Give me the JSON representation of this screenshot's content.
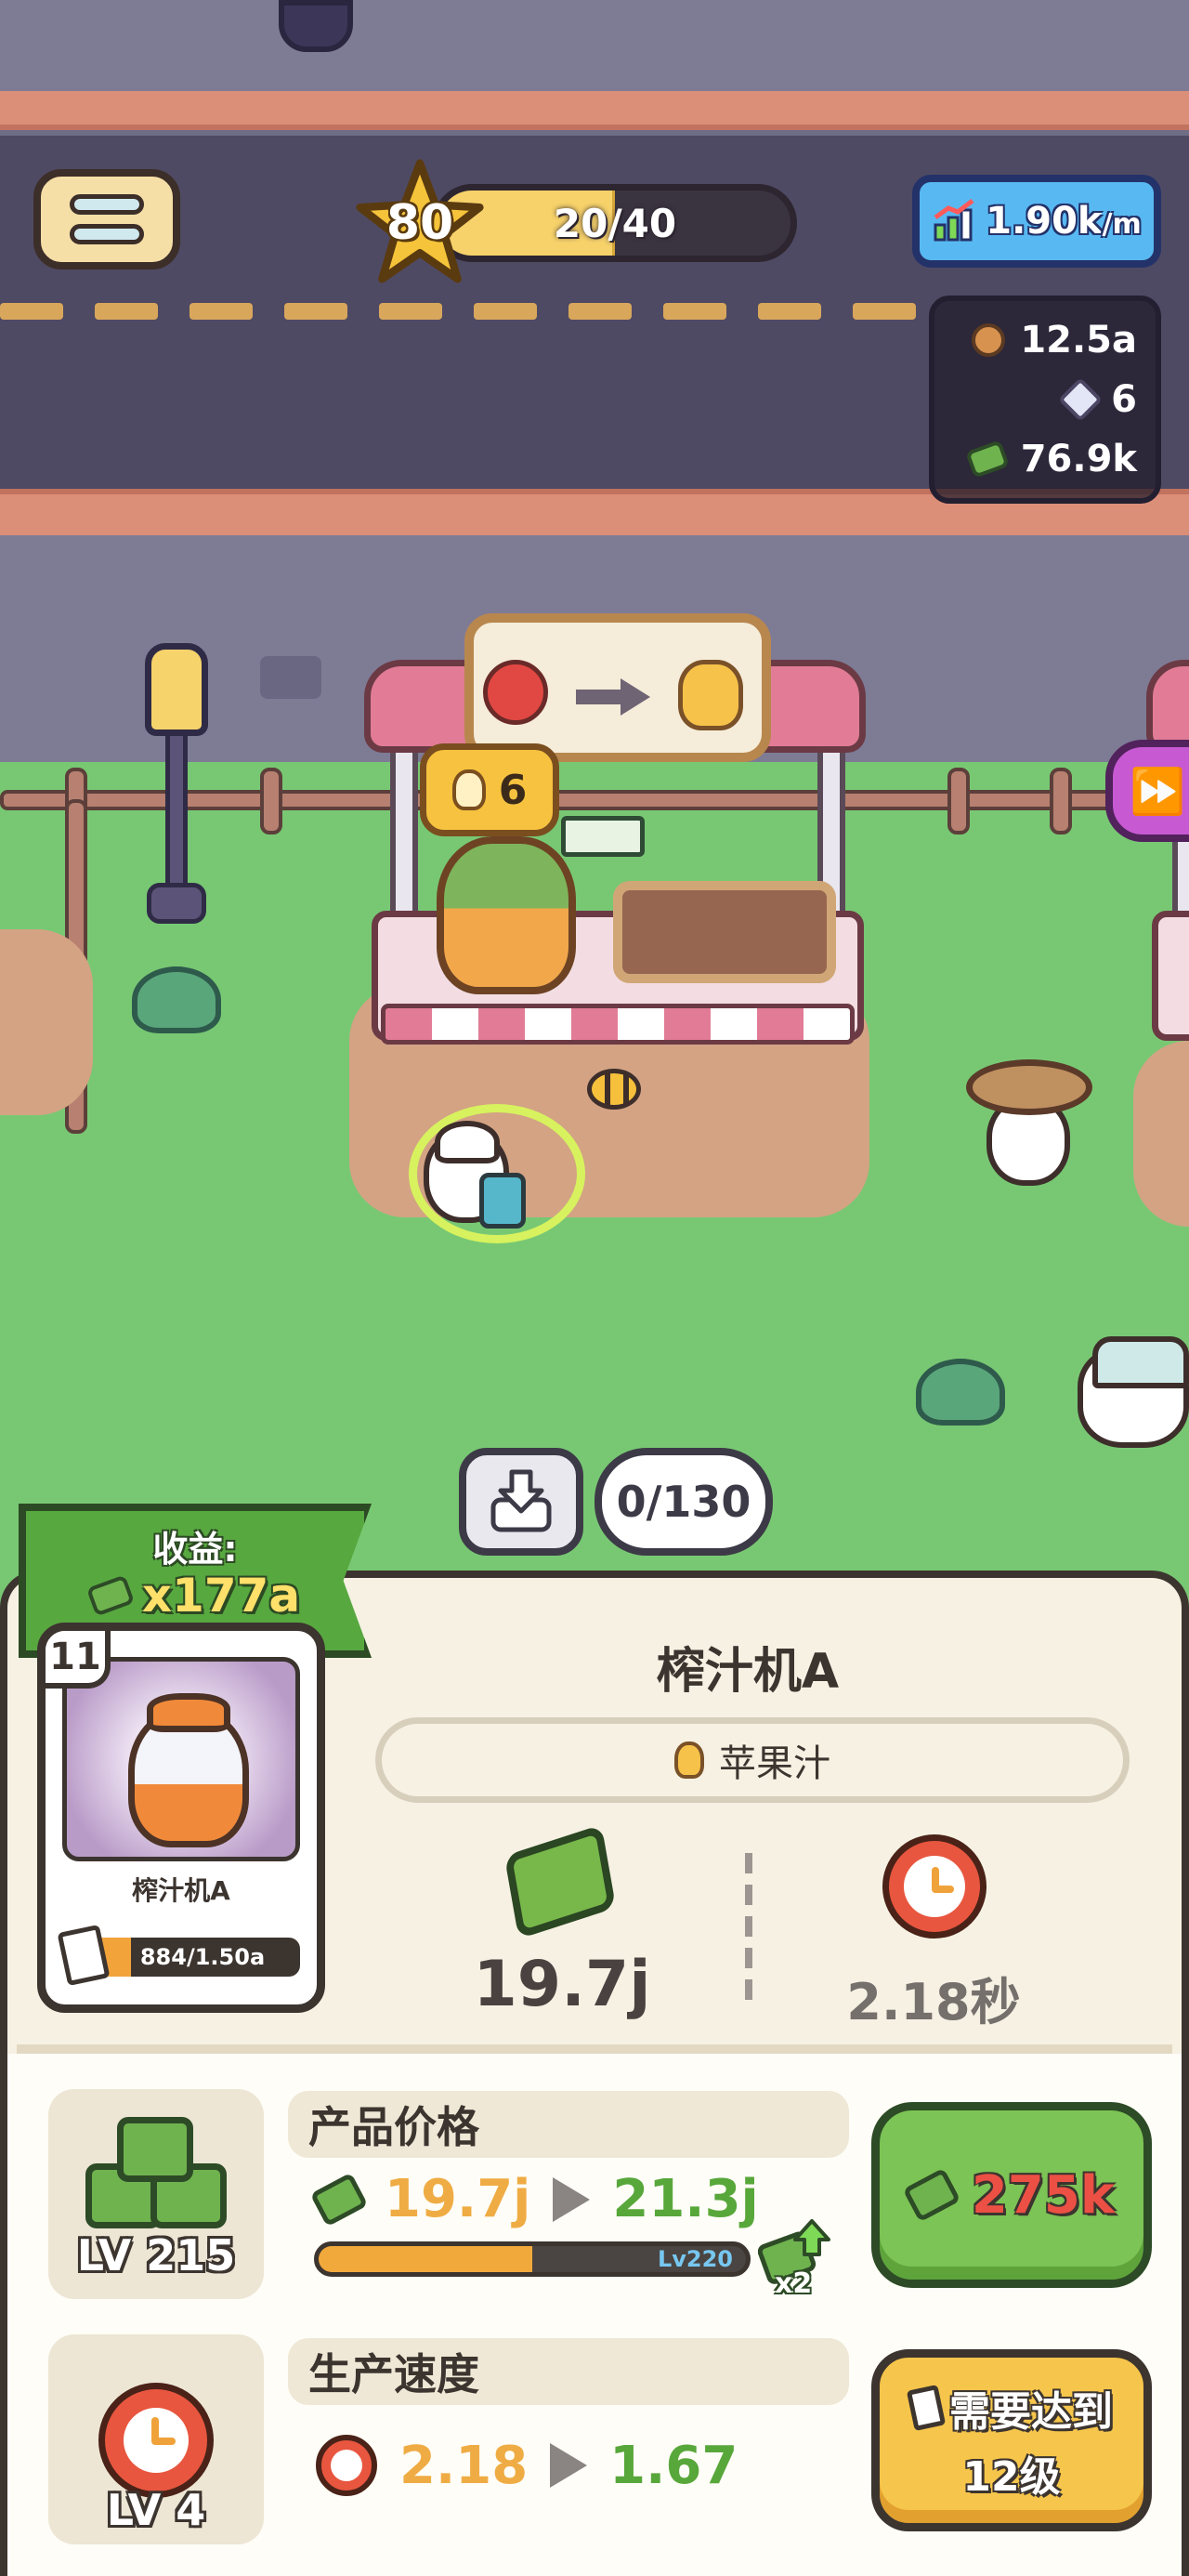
{
  "hud": {
    "player_level": "80",
    "xp_text": "20/40",
    "xp_fraction": 0.5,
    "income_rate": "1.90k",
    "income_unit": "/m",
    "resources": [
      {
        "icon": "cookie-icon",
        "value": "12.5a"
      },
      {
        "icon": "gem-icon",
        "value": "6"
      },
      {
        "icon": "cash-icon",
        "value": "76.9k"
      }
    ]
  },
  "stall": {
    "stock_count": "6",
    "input_icon": "apple-icon",
    "output_icon": "juice-jar-icon"
  },
  "storage": {
    "capacity_text": "0/130"
  },
  "banner": {
    "title": "收益:",
    "value": "x177a"
  },
  "machine_card": {
    "level": "11",
    "name": "榨汁机A",
    "progress_text": "884/1.50a",
    "progress_fraction": 0.27
  },
  "panel": {
    "title": "榨汁机A",
    "product": "苹果汁",
    "earnings": "19.7j",
    "time": "2.18秒"
  },
  "upgrades": {
    "price": {
      "level_label": "LV 215",
      "label": "产品价格",
      "old_value": "19.7j",
      "new_value": "21.3j",
      "milestone": "Lv220",
      "progress_fraction": 0.5,
      "multiplier": "x2",
      "cost": "275k"
    },
    "speed": {
      "level_label": "LV 4",
      "label": "生产速度",
      "old_value": "2.18",
      "new_value": "1.67",
      "requirement_line1": "需要达到",
      "requirement_line2": "12级"
    }
  },
  "colors": {
    "accent_green": "#7cc455",
    "accent_yellow": "#f6c54b",
    "cost_red": "#ec5044",
    "old_value_orange": "#efac44",
    "new_value_green": "#58a73b"
  }
}
